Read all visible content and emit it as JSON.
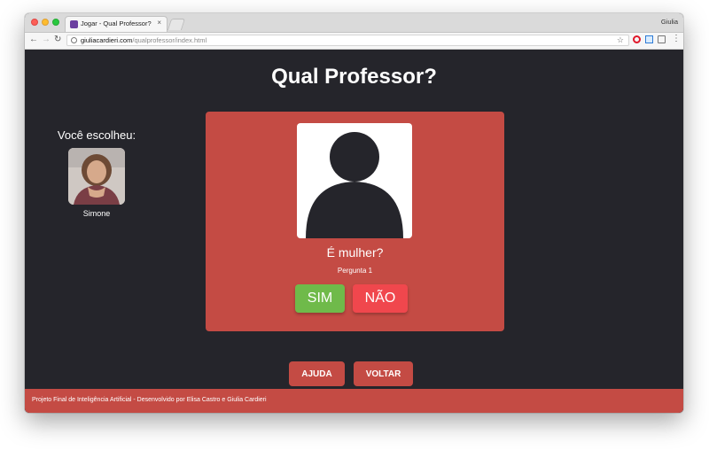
{
  "browser": {
    "tab_title": "Jogar - Qual Professor?",
    "tab_close": "×",
    "profile_name": "Giulia",
    "url_host": "giuliacardieri.com",
    "url_path": "/qualprofessor/index.html"
  },
  "game": {
    "title": "Qual Professor?",
    "chosen_label": "Você escolheu:",
    "chosen_name": "Simone",
    "question": "É mulher?",
    "question_number": "Pergunta 1",
    "yes_label": "SIM",
    "no_label": "NÃO",
    "help_label": "AJUDA",
    "back_label": "VOLTAR"
  },
  "footer": {
    "text": "Projeto Final de Inteligência Artificial - Desenvolvido por Elisa Castro e Giulia Cardieri"
  },
  "colors": {
    "background": "#25252b",
    "accent": "#c44b44",
    "yes": "#6fba4a",
    "no": "#f0474d"
  },
  "icons": [
    "back-arrow-icon",
    "forward-arrow-icon",
    "reload-icon",
    "info-icon",
    "star-icon",
    "opera-icon",
    "ruler-icon",
    "cast-icon",
    "menu-icon",
    "avatar-silhouette-icon"
  ]
}
